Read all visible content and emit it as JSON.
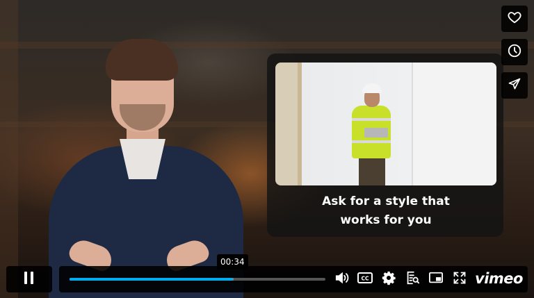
{
  "player": {
    "brand": "vimeo",
    "accent_color": "#00adef",
    "progress_fraction": 0.638,
    "buffered_fraction": 0.64,
    "current_time_tooltip": "00:34"
  },
  "info_card": {
    "caption_line1": "Ask for a style that",
    "caption_line2": "works for you"
  },
  "side_buttons": [
    {
      "name": "like",
      "icon": "heart-icon"
    },
    {
      "name": "watch-later",
      "icon": "clock-icon"
    },
    {
      "name": "share",
      "icon": "send-icon"
    }
  ],
  "controls": {
    "play_state_icon": "pause-icon",
    "icons": [
      "volume-icon",
      "cc-icon",
      "settings-icon",
      "transcript-icon",
      "pip-icon",
      "fullscreen-icon"
    ]
  }
}
